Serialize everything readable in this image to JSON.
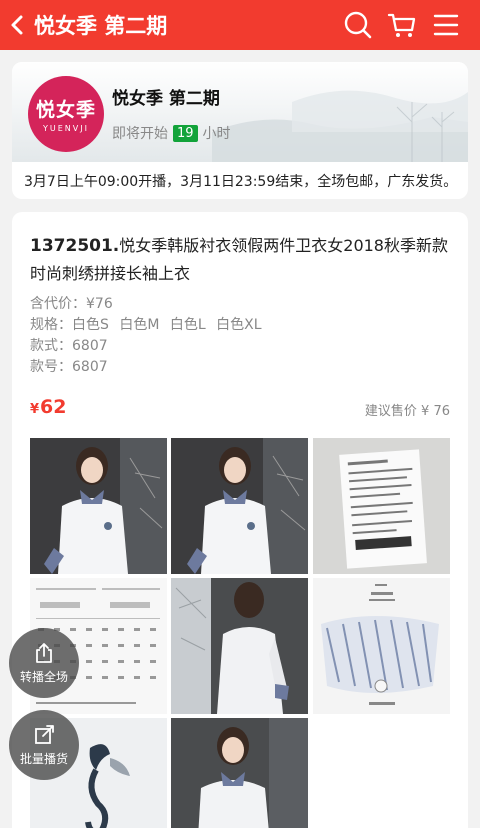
{
  "header": {
    "title": "悦女季 第二期",
    "icons": [
      "back-arrow-icon",
      "search-icon",
      "cart-icon",
      "menu-icon"
    ]
  },
  "banner": {
    "logo_text": "悦女季",
    "logo_sub": "YUENVJI",
    "shop_name": "悦女季 第二期",
    "countdown_prefix": "即将开始",
    "countdown_hours": "19",
    "countdown_suffix": "小时",
    "notice": "3月7日上午09:00开播，3月11日23:59结束，全场包邮，广东发货。"
  },
  "product": {
    "code": "1372501.",
    "title": "悦女季韩版衬衣领假两件卫衣女2018秋季新款时尚刺绣拼接长袖上衣",
    "price_with_fee_label": "含代价：",
    "price_with_fee_value": "¥76",
    "spec_label": "规格：",
    "specs": [
      "白色S",
      "白色M",
      "白色L",
      "白色XL"
    ],
    "style_label": "款式：",
    "style_value": "6807",
    "model_label": "款号：",
    "model_value": "6807",
    "price_symbol": "¥",
    "price": "62",
    "msrp_label": "建议售价",
    "msrp_value": "¥ 76"
  },
  "fabs": {
    "share_all": "转播全场",
    "batch_share": "批量播货"
  },
  "colors": {
    "brand_red": "#f23b2f",
    "logo_pink": "#d4245a",
    "badge_green": "#12a33a"
  }
}
